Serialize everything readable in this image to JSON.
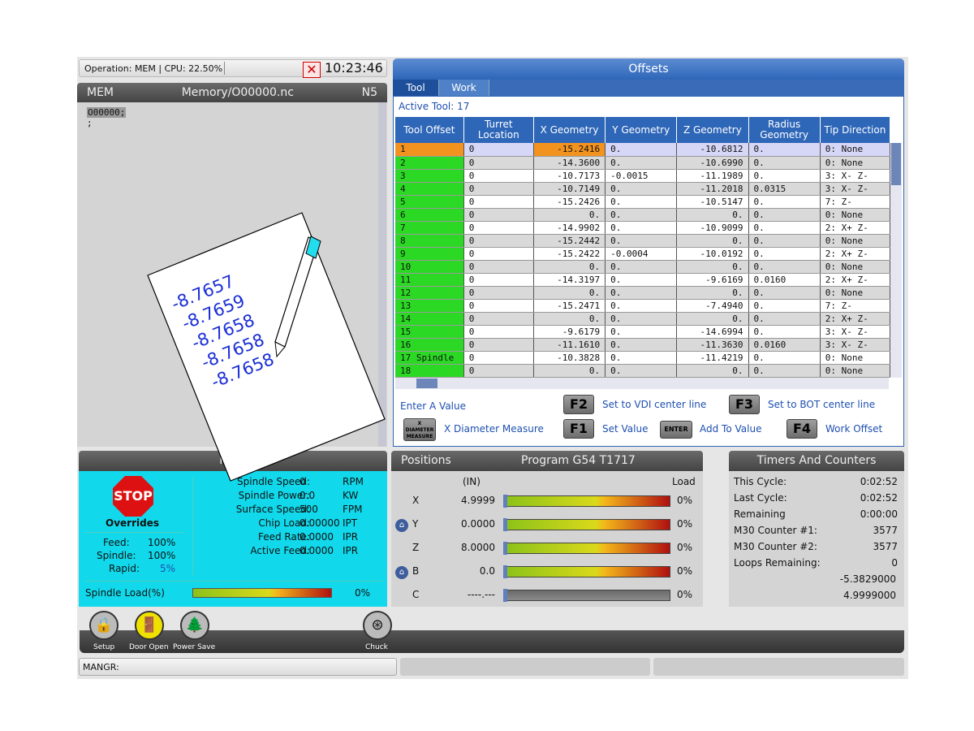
{
  "status": {
    "operation": "Operation: MEM | CPU: 22.50%",
    "clock": "10:23:46",
    "alarm_icon": "alarm-x-icon"
  },
  "program": {
    "mode": "MEM",
    "path": "Memory/O00000.nc",
    "line": "N5",
    "lines": [
      "O00000;",
      ";"
    ]
  },
  "offsets": {
    "title": "Offsets",
    "tabs": [
      "Tool",
      "Work"
    ],
    "active_tool": "Active Tool: 17",
    "columns": [
      "Tool Offset",
      "Turret Location",
      "X Geometry",
      "Y Geometry",
      "Z Geometry",
      "Radius Geometry",
      "Tip Direction"
    ],
    "rows": [
      [
        "1",
        "0",
        "-15.2416",
        "0.",
        "-10.6812",
        "0.",
        "0: None"
      ],
      [
        "2",
        "0",
        "-14.3600",
        "0.",
        "-10.6990",
        "0.",
        "0: None"
      ],
      [
        "3",
        "0",
        "-10.7173",
        "-0.0015",
        "-11.1989",
        "0.",
        "3: X- Z-"
      ],
      [
        "4",
        "0",
        "-10.7149",
        "0.",
        "-11.2018",
        "0.0315",
        "3: X- Z-"
      ],
      [
        "5",
        "0",
        "-15.2426",
        "0.",
        "-10.5147",
        "0.",
        "7: Z-"
      ],
      [
        "6",
        "0",
        "0.",
        "0.",
        "0.",
        "0.",
        "0: None"
      ],
      [
        "7",
        "0",
        "-14.9902",
        "0.",
        "-10.9099",
        "0.",
        "2: X+ Z-"
      ],
      [
        "8",
        "0",
        "-15.2442",
        "0.",
        "0.",
        "0.",
        "0: None"
      ],
      [
        "9",
        "0",
        "-15.2422",
        "-0.0004",
        "-10.0192",
        "0.",
        "2: X+ Z-"
      ],
      [
        "10",
        "0",
        "0.",
        "0.",
        "0.",
        "0.",
        "0: None"
      ],
      [
        "11",
        "0",
        "-14.3197",
        "0.",
        "-9.6169",
        "0.0160",
        "2: X+ Z-"
      ],
      [
        "12",
        "0",
        "0.",
        "0.",
        "0.",
        "0.",
        "0: None"
      ],
      [
        "13",
        "0",
        "-15.2471",
        "0.",
        "-7.4940",
        "0.",
        "7: Z-"
      ],
      [
        "14",
        "0",
        "0.",
        "0.",
        "0.",
        "0.",
        "2: X+ Z-"
      ],
      [
        "15",
        "0",
        "-9.6179",
        "0.",
        "-14.6994",
        "0.",
        "3: X- Z-"
      ],
      [
        "16",
        "0",
        "-11.1610",
        "0.",
        "-11.3630",
        "0.0160",
        "3: X- Z-"
      ],
      [
        "17 Spindle",
        "0",
        "-10.3828",
        "0.",
        "-11.4219",
        "0.",
        "0: None"
      ],
      [
        "18",
        "0",
        "0.",
        "0.",
        "0.",
        "0.",
        "0: None"
      ]
    ],
    "hints": {
      "enter": "Enter A Value",
      "f2_key": "F2",
      "f2": "Set to VDI center line",
      "f3_key": "F3",
      "f3": "Set to BOT center line",
      "diam_key": "X DIAMETER MEASURE",
      "diam": "X Diameter Measure",
      "f1_key": "F1",
      "f1": "Set Value",
      "enter_key": "ENTER",
      "enter_lbl": "Add To Value",
      "f4_key": "F4",
      "f4": "Work Offset"
    }
  },
  "note": {
    "values": [
      "-8.7657",
      "-8.7659",
      "-8.7658",
      "-8.7658",
      "-8.7658"
    ]
  },
  "maintenance": {
    "title": "Main",
    "stop": "STOP",
    "overrides": "Overrides",
    "feed_lbl": "Feed:",
    "feed": "100%",
    "spindle_lbl": "Spindle:",
    "spindle": "100%",
    "rapid_lbl": "Rapid:",
    "rapid": "5%",
    "params": [
      [
        "Spindle Speed:",
        "0",
        "RPM"
      ],
      [
        "Spindle Power:",
        "0.0",
        "KW"
      ],
      [
        "Surface Speed:",
        "500",
        "FPM"
      ],
      [
        "Chip Load:",
        "0.00000",
        "IPT"
      ],
      [
        "Feed Rate:",
        "0.0000",
        "IPR"
      ],
      [
        "Active Feed:",
        "0.0000",
        "IPR"
      ]
    ],
    "load_lbl": "Spindle Load(%)",
    "load": "0%",
    "load_level": 0
  },
  "positions": {
    "title": "Positions",
    "program": "Program G54 T1717",
    "unit": "(IN)",
    "load_hdr": "Load",
    "axes": [
      {
        "axis": "X",
        "value": "4.9999",
        "load": "0%"
      },
      {
        "axis": "Y",
        "value": "0.0000",
        "load": "0%"
      },
      {
        "axis": "Z",
        "value": "8.0000",
        "load": "0%"
      },
      {
        "axis": "B",
        "value": "0.0",
        "load": "0%"
      },
      {
        "axis": "C",
        "value": "----.---",
        "load": "0%"
      }
    ]
  },
  "timers": {
    "title": "Timers And Counters",
    "rows": [
      [
        "This Cycle:",
        "0:02:52"
      ],
      [
        "Last Cycle:",
        "0:02:52"
      ],
      [
        "Remaining",
        "0:00:00"
      ],
      [
        "M30 Counter #1:",
        "3577"
      ],
      [
        "M30 Counter #2:",
        "3577"
      ],
      [
        "Loops Remaining:",
        "0"
      ]
    ],
    "extra": [
      "-5.3829000",
      "4.9999000"
    ]
  },
  "bottom": {
    "setup": "Setup",
    "door": "Door Open",
    "power": "Power Save",
    "chuck": "Chuck",
    "cmd": "MANGR:"
  }
}
